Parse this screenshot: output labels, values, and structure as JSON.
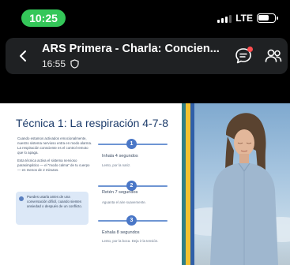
{
  "status_bar": {
    "time": "10:25",
    "network": "LTE",
    "battery_level": 0.7,
    "signal_bars": 3
  },
  "meeting": {
    "title": "ARS Primera - Charla: Concien...",
    "elapsed": "16:55",
    "back_icon": "chevron-left-icon",
    "security_icon": "shield-icon",
    "chat_icon": "chat-icon",
    "participants_icon": "people-icon",
    "chat_notification_color": "#ff4d4f"
  },
  "slide": {
    "title": "Técnica 1: La respiración 4-7-8",
    "intro_paragraphs": [
      "Cuando estamos activados emocionalmente, nuestro sistema nervioso entra en modo alarma. La respiración consciente es el control remoto que lo apaga.",
      "Esta técnica activa el sistema nervioso parasimpático — el \"modo calma\" de tu cuerpo — en menos de 2 minutos."
    ],
    "tip": "Puedes usarla antes de una conversación difícil, cuando sientes ansiedad o después de un conflicto.",
    "steps": [
      {
        "number": "1",
        "title": "Inhala 4 segundos",
        "description": "Lento, por la nariz."
      },
      {
        "number": "2",
        "title": "Retén 7 segundos",
        "description": "Aguanta el aire suavemente."
      },
      {
        "number": "3",
        "title": "Exhala 8 segundos",
        "description": "Lento, por la boca. Deja ir la tensión."
      }
    ],
    "colors": {
      "title": "#1d3c6b",
      "accent": "#4a77c7",
      "tip_background": "#dce8f7",
      "stripe_teal": "#2f7f86",
      "stripe_yellow": "#f2c230",
      "stripe_blue": "#2f5fa8"
    }
  }
}
